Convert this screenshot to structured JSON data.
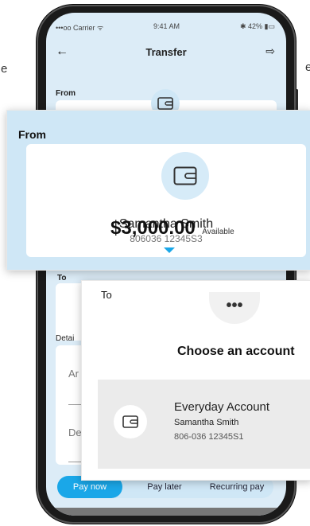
{
  "stray": {
    "left": "e",
    "right": "e"
  },
  "status": {
    "carrier": "•••oo Carrier ᯤ",
    "time": "9:41 AM",
    "battery": "✱ 42% ▮▭"
  },
  "nav": {
    "title": "Transfer",
    "back_icon": "←",
    "logout_icon": "⇨"
  },
  "phone": {
    "from_label": "From",
    "to_label": "To",
    "details_label": "Detai",
    "amount_placeholder": "Ar",
    "desc_placeholder": "De"
  },
  "pay": {
    "now": "Pay now",
    "later": "Pay later",
    "recurring": "Recurring pay"
  },
  "from_panel": {
    "label": "From",
    "name": "Samantha Smith",
    "account": "806036 12345S3",
    "amount": "$3,000.00",
    "available": "Available"
  },
  "to_panel": {
    "label": "To",
    "more": "•••",
    "choose": "Choose an account",
    "account_name": "Everyday Account",
    "account_holder": "Samantha Smith",
    "account_number": "806-036  12345S1"
  },
  "colors": {
    "accent": "#1aa7e8",
    "background": "#dcecf7"
  }
}
